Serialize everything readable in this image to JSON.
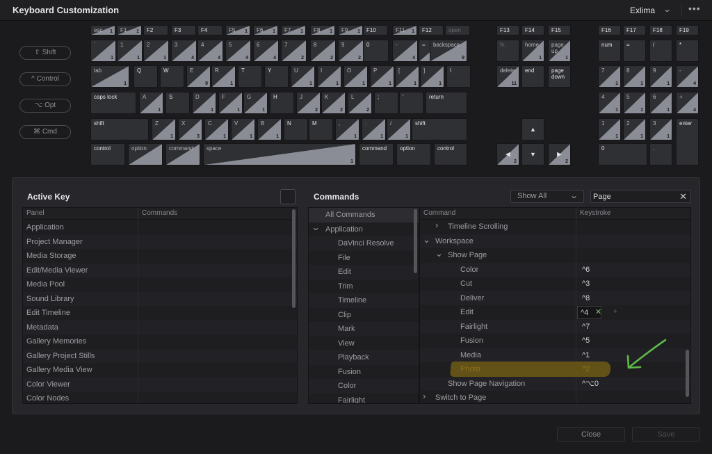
{
  "title": "Keyboard Customization",
  "preset": "Exlima",
  "modifiers": [
    "⇧ Shift",
    "^ Control",
    "⌥ Opt",
    "⌘ Cmd"
  ],
  "keys": [
    {
      "l": "esc",
      "c": "1",
      "t": 1
    },
    {
      "l": "F1",
      "c": "1",
      "t": 1
    },
    {
      "l": "F2",
      "c": "",
      "t": 0
    },
    {
      "l": "F3",
      "c": "",
      "t": 0
    },
    {
      "l": "F4",
      "c": "",
      "t": 0
    },
    {
      "l": "F5",
      "c": "1",
      "t": 1
    },
    {
      "l": "F6",
      "c": "1",
      "t": 1
    },
    {
      "l": "F7",
      "c": "1",
      "t": 1
    },
    {
      "l": "F8",
      "c": "1",
      "t": 1
    },
    {
      "l": "F9",
      "c": "1",
      "t": 1
    },
    {
      "l": "F10",
      "c": "",
      "t": 0
    },
    {
      "l": "F11",
      "c": "1",
      "t": 1
    },
    {
      "l": "F12",
      "c": "",
      "t": 0
    },
    {
      "l": "open",
      "c": "",
      "t": 0,
      "dim": 1
    },
    {
      "l": "`",
      "c": "1",
      "t": 1
    },
    {
      "l": "1",
      "c": "1",
      "t": 1
    },
    {
      "l": "2",
      "c": "1",
      "t": 1
    },
    {
      "l": "3",
      "c": "4",
      "t": 1
    },
    {
      "l": "4",
      "c": "4",
      "t": 1
    },
    {
      "l": "5",
      "c": "4",
      "t": 1
    },
    {
      "l": "6",
      "c": "4",
      "t": 1
    },
    {
      "l": "7",
      "c": "2",
      "t": 1
    },
    {
      "l": "8",
      "c": "2",
      "t": 1
    },
    {
      "l": "9",
      "c": "2",
      "t": 1
    },
    {
      "l": "0",
      "c": "",
      "t": 0
    },
    {
      "l": "-",
      "c": "4",
      "t": 1
    },
    {
      "l": "=",
      "c": "4",
      "t": 1
    },
    {
      "l": "backspace",
      "c": "9",
      "t": 1
    },
    {
      "l": "tab",
      "c": "1",
      "t": 1
    },
    {
      "l": "Q",
      "c": "",
      "t": 0
    },
    {
      "l": "W",
      "c": "",
      "t": 0
    },
    {
      "l": "E",
      "c": "9",
      "t": 1
    },
    {
      "l": "R",
      "c": "1",
      "t": 1
    },
    {
      "l": "T",
      "c": "",
      "t": 0
    },
    {
      "l": "Y",
      "c": "",
      "t": 0
    },
    {
      "l": "U",
      "c": "1",
      "t": 1
    },
    {
      "l": "I",
      "c": "1",
      "t": 1
    },
    {
      "l": "O",
      "c": "1",
      "t": 1
    },
    {
      "l": "P",
      "c": "1",
      "t": 1
    },
    {
      "l": "[",
      "c": "1",
      "t": 1
    },
    {
      "l": "]",
      "c": "1",
      "t": 1
    },
    {
      "l": "\\",
      "c": "",
      "t": 0
    },
    {
      "l": "caps lock",
      "c": "",
      "t": 0
    },
    {
      "l": "A",
      "c": "1",
      "t": 1
    },
    {
      "l": "S",
      "c": "",
      "t": 0
    },
    {
      "l": "D",
      "c": "1",
      "t": 1
    },
    {
      "l": "F",
      "c": "1",
      "t": 1
    },
    {
      "l": "G",
      "c": "1",
      "t": 1
    },
    {
      "l": "H",
      "c": "",
      "t": 0
    },
    {
      "l": "J",
      "c": "2",
      "t": 1
    },
    {
      "l": "K",
      "c": "2",
      "t": 1
    },
    {
      "l": "L",
      "c": "2",
      "t": 1
    },
    {
      "l": ";",
      "c": "",
      "t": 0
    },
    {
      "l": "'",
      "c": "",
      "t": 0
    },
    {
      "l": "return",
      "c": "",
      "t": 0
    },
    {
      "l": "shift",
      "c": "",
      "t": 0
    },
    {
      "l": "Z",
      "c": "1",
      "t": 1
    },
    {
      "l": "X",
      "c": "3",
      "t": 1
    },
    {
      "l": "C",
      "c": "1",
      "t": 1
    },
    {
      "l": "V",
      "c": "1",
      "t": 1
    },
    {
      "l": "B",
      "c": "1",
      "t": 1
    },
    {
      "l": "N",
      "c": "",
      "t": 0
    },
    {
      "l": "M",
      "c": "",
      "t": 0
    },
    {
      "l": ",",
      "c": "1",
      "t": 1
    },
    {
      "l": ".",
      "c": "1",
      "t": 1
    },
    {
      "l": "/",
      "c": "1",
      "t": 1
    },
    {
      "l": "shift",
      "c": "",
      "t": 0
    },
    {
      "l": "control",
      "c": "",
      "t": 0
    },
    {
      "l": "option",
      "c": "",
      "t": 1
    },
    {
      "l": "command",
      "c": "",
      "t": 1
    },
    {
      "l": "space",
      "c": "1",
      "t": 1
    },
    {
      "l": "command",
      "c": "",
      "t": 0
    },
    {
      "l": "option",
      "c": "",
      "t": 0
    },
    {
      "l": "control",
      "c": "",
      "t": 0
    },
    {
      "l": "F13",
      "c": "",
      "t": 0
    },
    {
      "l": "F14",
      "c": "",
      "t": 0
    },
    {
      "l": "F15",
      "c": "",
      "t": 0
    },
    {
      "l": "fn",
      "c": "",
      "t": 0,
      "dim": 1
    },
    {
      "l": "home",
      "c": "1",
      "t": 1
    },
    {
      "l": "page up",
      "c": "1",
      "t": 1
    },
    {
      "l": "delete",
      "c": "11",
      "t": 1
    },
    {
      "l": "end",
      "c": "",
      "t": 0
    },
    {
      "l": "page down",
      "c": "",
      "t": 0
    },
    {
      "l": "▲",
      "c": "",
      "t": 0
    },
    {
      "l": "◀",
      "c": "2",
      "t": 1
    },
    {
      "l": "▼",
      "c": "",
      "t": 0
    },
    {
      "l": "▶",
      "c": "2",
      "t": 1
    },
    {
      "l": "F16",
      "c": "",
      "t": 0
    },
    {
      "l": "F17",
      "c": "",
      "t": 0
    },
    {
      "l": "F18",
      "c": "",
      "t": 0
    },
    {
      "l": "F19",
      "c": "",
      "t": 0
    },
    {
      "l": "num",
      "c": "",
      "t": 0
    },
    {
      "l": "=",
      "c": "",
      "t": 0
    },
    {
      "l": "/",
      "c": "",
      "t": 0
    },
    {
      "l": "*",
      "c": "",
      "t": 0
    },
    {
      "l": "7",
      "c": "1",
      "t": 1
    },
    {
      "l": "8",
      "c": "1",
      "t": 1
    },
    {
      "l": "9",
      "c": "1",
      "t": 1
    },
    {
      "l": "-",
      "c": "4",
      "t": 1
    },
    {
      "l": "4",
      "c": "1",
      "t": 1
    },
    {
      "l": "5",
      "c": "1",
      "t": 1
    },
    {
      "l": "6",
      "c": "1",
      "t": 1
    },
    {
      "l": "+",
      "c": "4",
      "t": 1
    },
    {
      "l": "1",
      "c": "1",
      "t": 1
    },
    {
      "l": "2",
      "c": "1",
      "t": 1
    },
    {
      "l": "3",
      "c": "1",
      "t": 1
    },
    {
      "l": "enter",
      "c": "",
      "t": 0
    },
    {
      "l": "0",
      "c": "",
      "t": 0
    },
    {
      "l": ".",
      "c": "",
      "t": 0
    }
  ],
  "active_key": {
    "title": "Active Key",
    "headers": [
      "Panel",
      "Commands"
    ],
    "rows": [
      "Application",
      "Project Manager",
      "Media Storage",
      "Edit/Media Viewer",
      "Media Pool",
      "Sound Library",
      "Edit Timeline",
      "Metadata",
      "Gallery Memories",
      "Gallery Project Stills",
      "Gallery Media View",
      "Color Viewer",
      "Color Nodes"
    ]
  },
  "commands": {
    "title": "Commands",
    "filter": "Show All",
    "search_value": "Page",
    "categories": [
      {
        "label": "All Commands",
        "indent": 0,
        "chev": ""
      },
      {
        "label": "Application",
        "indent": 0,
        "chev": "⌄"
      },
      {
        "label": "DaVinci Resolve",
        "indent": 1,
        "chev": ""
      },
      {
        "label": "File",
        "indent": 1,
        "chev": ""
      },
      {
        "label": "Edit",
        "indent": 1,
        "chev": ""
      },
      {
        "label": "Trim",
        "indent": 1,
        "chev": ""
      },
      {
        "label": "Timeline",
        "indent": 1,
        "chev": ""
      },
      {
        "label": "Clip",
        "indent": 1,
        "chev": ""
      },
      {
        "label": "Mark",
        "indent": 1,
        "chev": ""
      },
      {
        "label": "View",
        "indent": 1,
        "chev": ""
      },
      {
        "label": "Playback",
        "indent": 1,
        "chev": ""
      },
      {
        "label": "Fusion",
        "indent": 1,
        "chev": ""
      },
      {
        "label": "Color",
        "indent": 1,
        "chev": ""
      },
      {
        "label": "Fairlight",
        "indent": 1,
        "chev": ""
      }
    ],
    "headers": [
      "Command",
      "Keystroke"
    ],
    "rows": [
      {
        "label": "Timeline Scrolling",
        "indent": 1,
        "chev": "›",
        "key": ""
      },
      {
        "label": "Workspace",
        "indent": 0,
        "chev": "⌄",
        "key": ""
      },
      {
        "label": "Show Page",
        "indent": 1,
        "chev": "⌄",
        "key": ""
      },
      {
        "label": "Color",
        "indent": 2,
        "chev": "",
        "key": "^6"
      },
      {
        "label": "Cut",
        "indent": 2,
        "chev": "",
        "key": "^3"
      },
      {
        "label": "Deliver",
        "indent": 2,
        "chev": "",
        "key": "^8"
      },
      {
        "label": "Edit",
        "indent": 2,
        "chev": "",
        "key": "^4"
      },
      {
        "label": "Fairlight",
        "indent": 2,
        "chev": "",
        "key": "^7"
      },
      {
        "label": "Fusion",
        "indent": 2,
        "chev": "",
        "key": "^5"
      },
      {
        "label": "Media",
        "indent": 2,
        "chev": "",
        "key": "^1"
      },
      {
        "label": "Photo",
        "indent": 2,
        "chev": "",
        "key": "^2"
      },
      {
        "label": "Show Page Navigation",
        "indent": 1,
        "chev": "",
        "key": "^⌥0"
      },
      {
        "label": "Switch to Page",
        "indent": 0,
        "chev": "›",
        "key": ""
      }
    ]
  },
  "buttons": {
    "close": "Close",
    "save": "Save"
  },
  "colors": {
    "highlight": "#76621a",
    "arrow": "#5fb84a",
    "key_shade": "#8a8d95"
  }
}
